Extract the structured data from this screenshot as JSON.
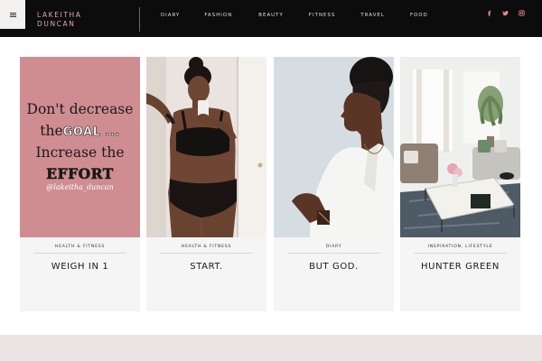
{
  "header": {
    "logo_line1": "LAKEITHA",
    "logo_line2": "DUNCAN",
    "nav": [
      "DIARY",
      "FASHION",
      "BEAUTY",
      "FITNESS",
      "TRAVEL",
      "FOOD"
    ],
    "social_icons": [
      "facebook-icon",
      "twitter-icon",
      "instagram-icon"
    ]
  },
  "colors": {
    "header_bg": "#0c0c0c",
    "logo": "#dca8a8",
    "quote_card_bg": "#cf8d92",
    "footer_band": "#ebe4e4"
  },
  "posts": [
    {
      "category": "HEALTH & FITNESS",
      "title": "WEIGH IN 1",
      "quote": {
        "line1": "Don't decrease",
        "line2_a": "the",
        "line2_b": "GOAL ...",
        "line3": "Increase the",
        "line4": "EFFORT",
        "handle": "@lakeitha_duncan"
      }
    },
    {
      "category": "HEALTH & FITNESS",
      "title": "START."
    },
    {
      "category": "DIARY",
      "title": "BUT GOD."
    },
    {
      "category": "INSPIRATION, LIFESTYLE",
      "title": "HUNTER GREEN"
    }
  ]
}
